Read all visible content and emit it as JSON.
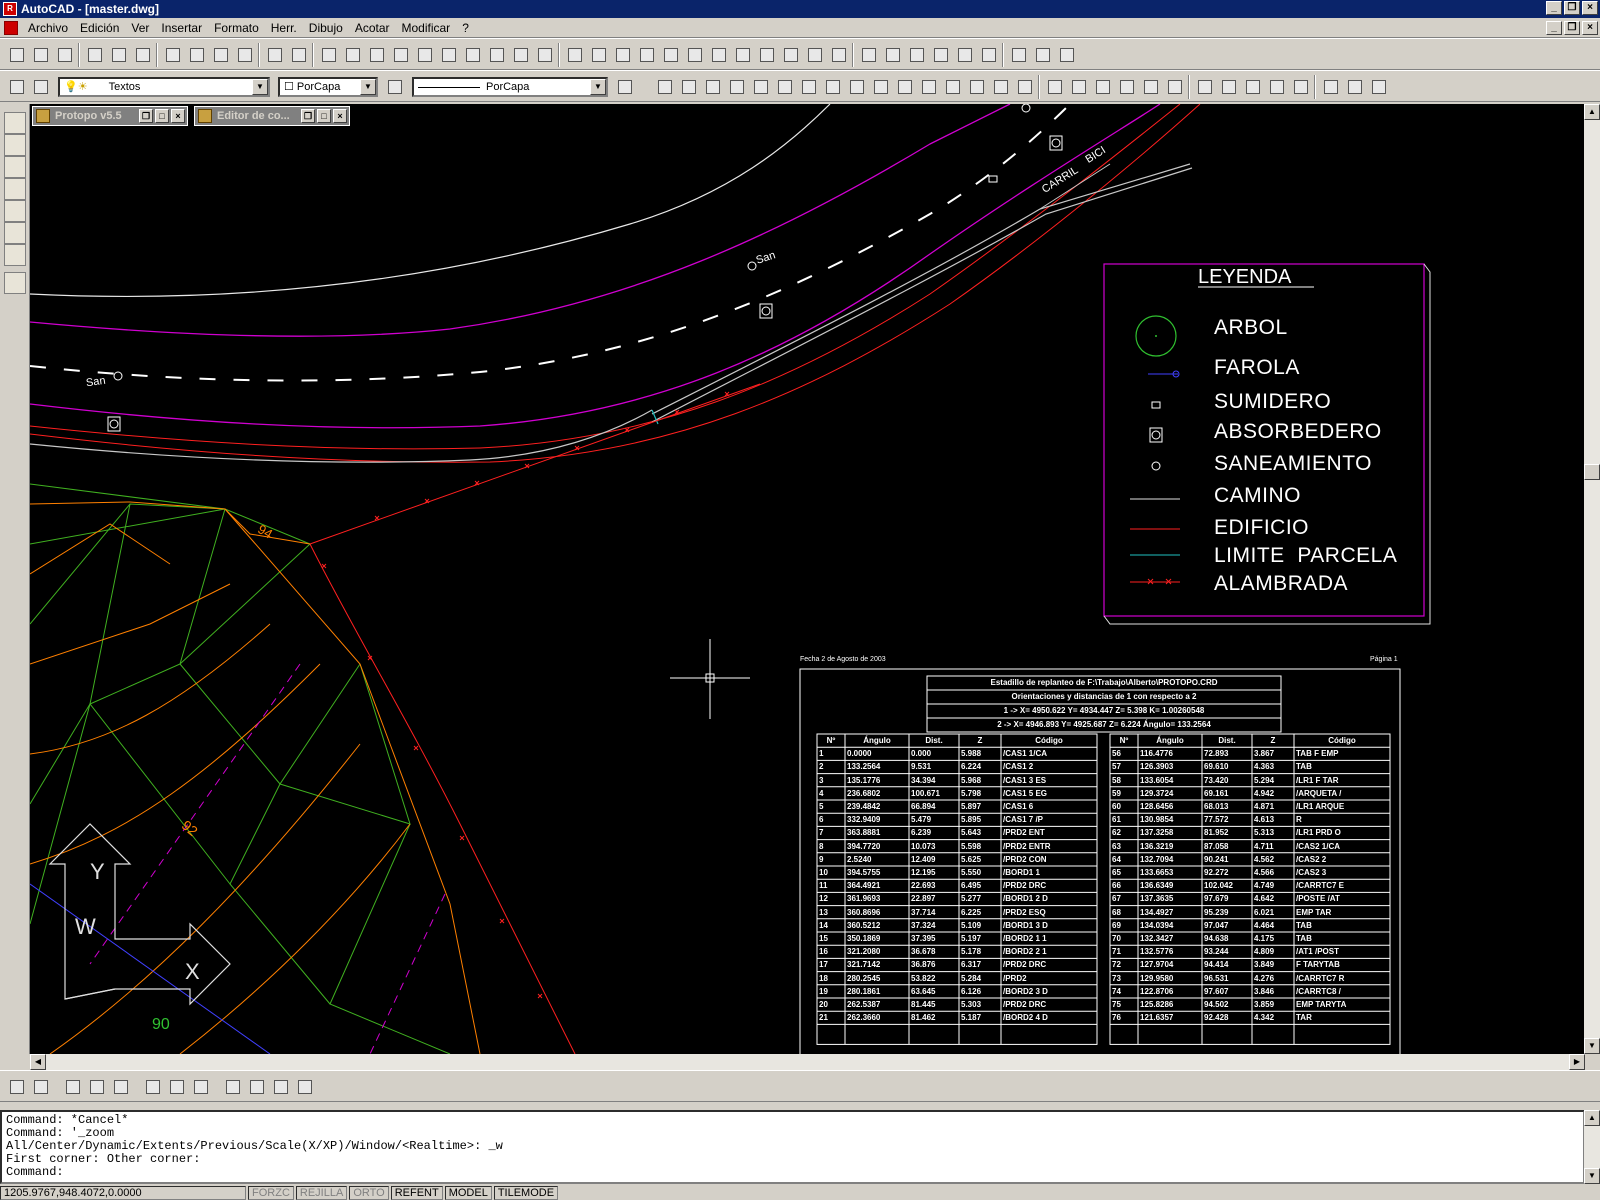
{
  "window": {
    "title": "AutoCAD - [master.dwg]"
  },
  "menu": {
    "items": [
      "Archivo",
      "Edición",
      "Ver",
      "Insertar",
      "Formato",
      "Herr.",
      "Dibujo",
      "Acotar",
      "Modificar",
      "?"
    ]
  },
  "properties_bar": {
    "layer": "Textos",
    "color": "PorCapa",
    "linetype": "PorCapa"
  },
  "subwindows": [
    {
      "title": "Protopo v5.5"
    },
    {
      "title": "Editor de co..."
    }
  ],
  "drawing": {
    "labels": {
      "san1": "San",
      "san2": "San",
      "carril": "CARRIL",
      "bici": "BICI",
      "contour94": "94",
      "contour92": "92",
      "contour90": "90"
    },
    "legend": {
      "title": "LEYENDA",
      "items": [
        "ARBOL",
        "FAROLA",
        "SUMIDERO",
        "ABSORBEDERO",
        "SANEAMIENTO",
        "CAMINO",
        "EDIFICIO",
        "LIMITE  PARCELA",
        "ALAMBRADA"
      ]
    },
    "report": {
      "date": "Fecha 2 de Agosto de 2003",
      "page": "Página 1",
      "header": [
        "Estadillo de replanteo de F:\\Trabajo\\Alberto\\PROTOPO.CRD",
        "Orientaciones y distancias de 1 con respecto a 2",
        "1 -> X= 4950.622    Y= 4934.447    Z= 5.398    K= 1.00260548",
        "2 -> X= 4946.893    Y= 4925.687    Z= 6.224    Ángulo= 133.2564"
      ],
      "columns": [
        "Nº",
        "Ángulo",
        "Dist.",
        "Z",
        "Código"
      ],
      "left_rows": [
        [
          "1",
          "0.0000",
          "0.000",
          "5.988",
          "/CAS1 1/CA"
        ],
        [
          "2",
          "133.2564",
          "9.531",
          "6.224",
          "/CAS1 2"
        ],
        [
          "3",
          "135.1776",
          "34.394",
          "5.968",
          "/CAS1 3 ES"
        ],
        [
          "4",
          "236.6802",
          "100.671",
          "5.798",
          "/CAS1 5 EG"
        ],
        [
          "5",
          "239.4842",
          "66.894",
          "5.897",
          "/CAS1 6"
        ],
        [
          "6",
          "332.9409",
          "5.479",
          "5.895",
          "/CAS1 7 /P"
        ],
        [
          "7",
          "363.8881",
          "6.239",
          "5.643",
          "/PRD2 ENT"
        ],
        [
          "8",
          "394.7720",
          "10.073",
          "5.598",
          "/PRD2 ENTR"
        ],
        [
          "9",
          "2.5240",
          "12.409",
          "5.625",
          "/PRD2 CON"
        ],
        [
          "10",
          "394.5755",
          "12.195",
          "5.550",
          "/BORD1 1"
        ],
        [
          "11",
          "364.4921",
          "22.693",
          "6.495",
          "/PRD2 DRC"
        ],
        [
          "12",
          "361.9693",
          "22.897",
          "5.277",
          "/BORD1 2 D"
        ],
        [
          "13",
          "360.8696",
          "37.714",
          "6.225",
          "/PRD2 ESQ"
        ],
        [
          "14",
          "360.5212",
          "37.324",
          "5.109",
          "/BORD1 3 D"
        ],
        [
          "15",
          "350.1869",
          "37.395",
          "5.197",
          "/BORD2 1 1"
        ],
        [
          "16",
          "321.2080",
          "36.678",
          "5.178",
          "/BORD2 2 1"
        ],
        [
          "17",
          "321.7142",
          "36.876",
          "6.317",
          "/PRD2 DRC"
        ],
        [
          "18",
          "280.2545",
          "53.822",
          "5.284",
          "/PRD2"
        ],
        [
          "19",
          "280.1861",
          "63.645",
          "6.126",
          "/BORD2 3 D"
        ],
        [
          "20",
          "262.5387",
          "81.445",
          "5.303",
          "/PRD2 DRC"
        ],
        [
          "21",
          "262.3660",
          "81.462",
          "5.187",
          "/BORD2 4 D"
        ]
      ],
      "right_rows": [
        [
          "56",
          "116.4776",
          "72.893",
          "3.867",
          "TAB F EMP"
        ],
        [
          "57",
          "126.3903",
          "69.610",
          "4.363",
          "TAB"
        ],
        [
          "58",
          "133.6054",
          "73.420",
          "5.294",
          "/LR1 F TAR"
        ],
        [
          "59",
          "129.3724",
          "69.161",
          "4.942",
          "/ARQUETA /"
        ],
        [
          "60",
          "128.6456",
          "68.013",
          "4.871",
          "/LR1 ARQUE"
        ],
        [
          "61",
          "130.9854",
          "77.572",
          "4.613",
          "R"
        ],
        [
          "62",
          "137.3258",
          "81.952",
          "5.313",
          "/LR1 PRD O"
        ],
        [
          "63",
          "136.3219",
          "87.058",
          "4.711",
          "/CAS2 1/CA"
        ],
        [
          "64",
          "132.7094",
          "90.241",
          "4.562",
          "/CAS2 2"
        ],
        [
          "65",
          "133.6653",
          "92.272",
          "4.566",
          "/CAS2 3"
        ],
        [
          "66",
          "136.6349",
          "102.042",
          "4.749",
          "/CARRTC7 E"
        ],
        [
          "67",
          "137.3635",
          "97.679",
          "4.642",
          "/POSTE /AT"
        ],
        [
          "68",
          "134.4927",
          "95.239",
          "6.021",
          "EMP TAR"
        ],
        [
          "69",
          "134.0394",
          "97.047",
          "4.464",
          "TAB"
        ],
        [
          "70",
          "132.3427",
          "94.638",
          "4.175",
          "TAB"
        ],
        [
          "71",
          "132.5776",
          "93.244",
          "4.809",
          "/AT1 /POST"
        ],
        [
          "72",
          "127.9704",
          "94.414",
          "3.849",
          "F TARYTAB"
        ],
        [
          "73",
          "129.9580",
          "96.531",
          "4.276",
          "/CARRTC7 R"
        ],
        [
          "74",
          "122.8706",
          "97.607",
          "3.846",
          "/CARRTC8 /"
        ],
        [
          "75",
          "125.8286",
          "94.502",
          "3.859",
          "EMP TARYTA"
        ],
        [
          "76",
          "121.6357",
          "92.428",
          "4.342",
          "TAR"
        ]
      ]
    }
  },
  "command": {
    "lines": [
      "Command: *Cancel*",
      "Command: '_zoom",
      "All/Center/Dynamic/Extents/Previous/Scale(X/XP)/Window/<Realtime>: _w",
      "First corner: Other corner:",
      "Command:"
    ]
  },
  "status": {
    "coords": "1205.9767,948.4072,0.0000",
    "toggles": [
      "FORZC",
      "REJILLA",
      "ORTO",
      "REFENT",
      "MODEL",
      "TILEMODE"
    ]
  },
  "colors": {
    "magenta": "#d000d0",
    "red": "#ff2020",
    "green": "#30c030",
    "orange": "#ff8000",
    "cyan": "#20c0c0",
    "blue": "#4040ff"
  }
}
